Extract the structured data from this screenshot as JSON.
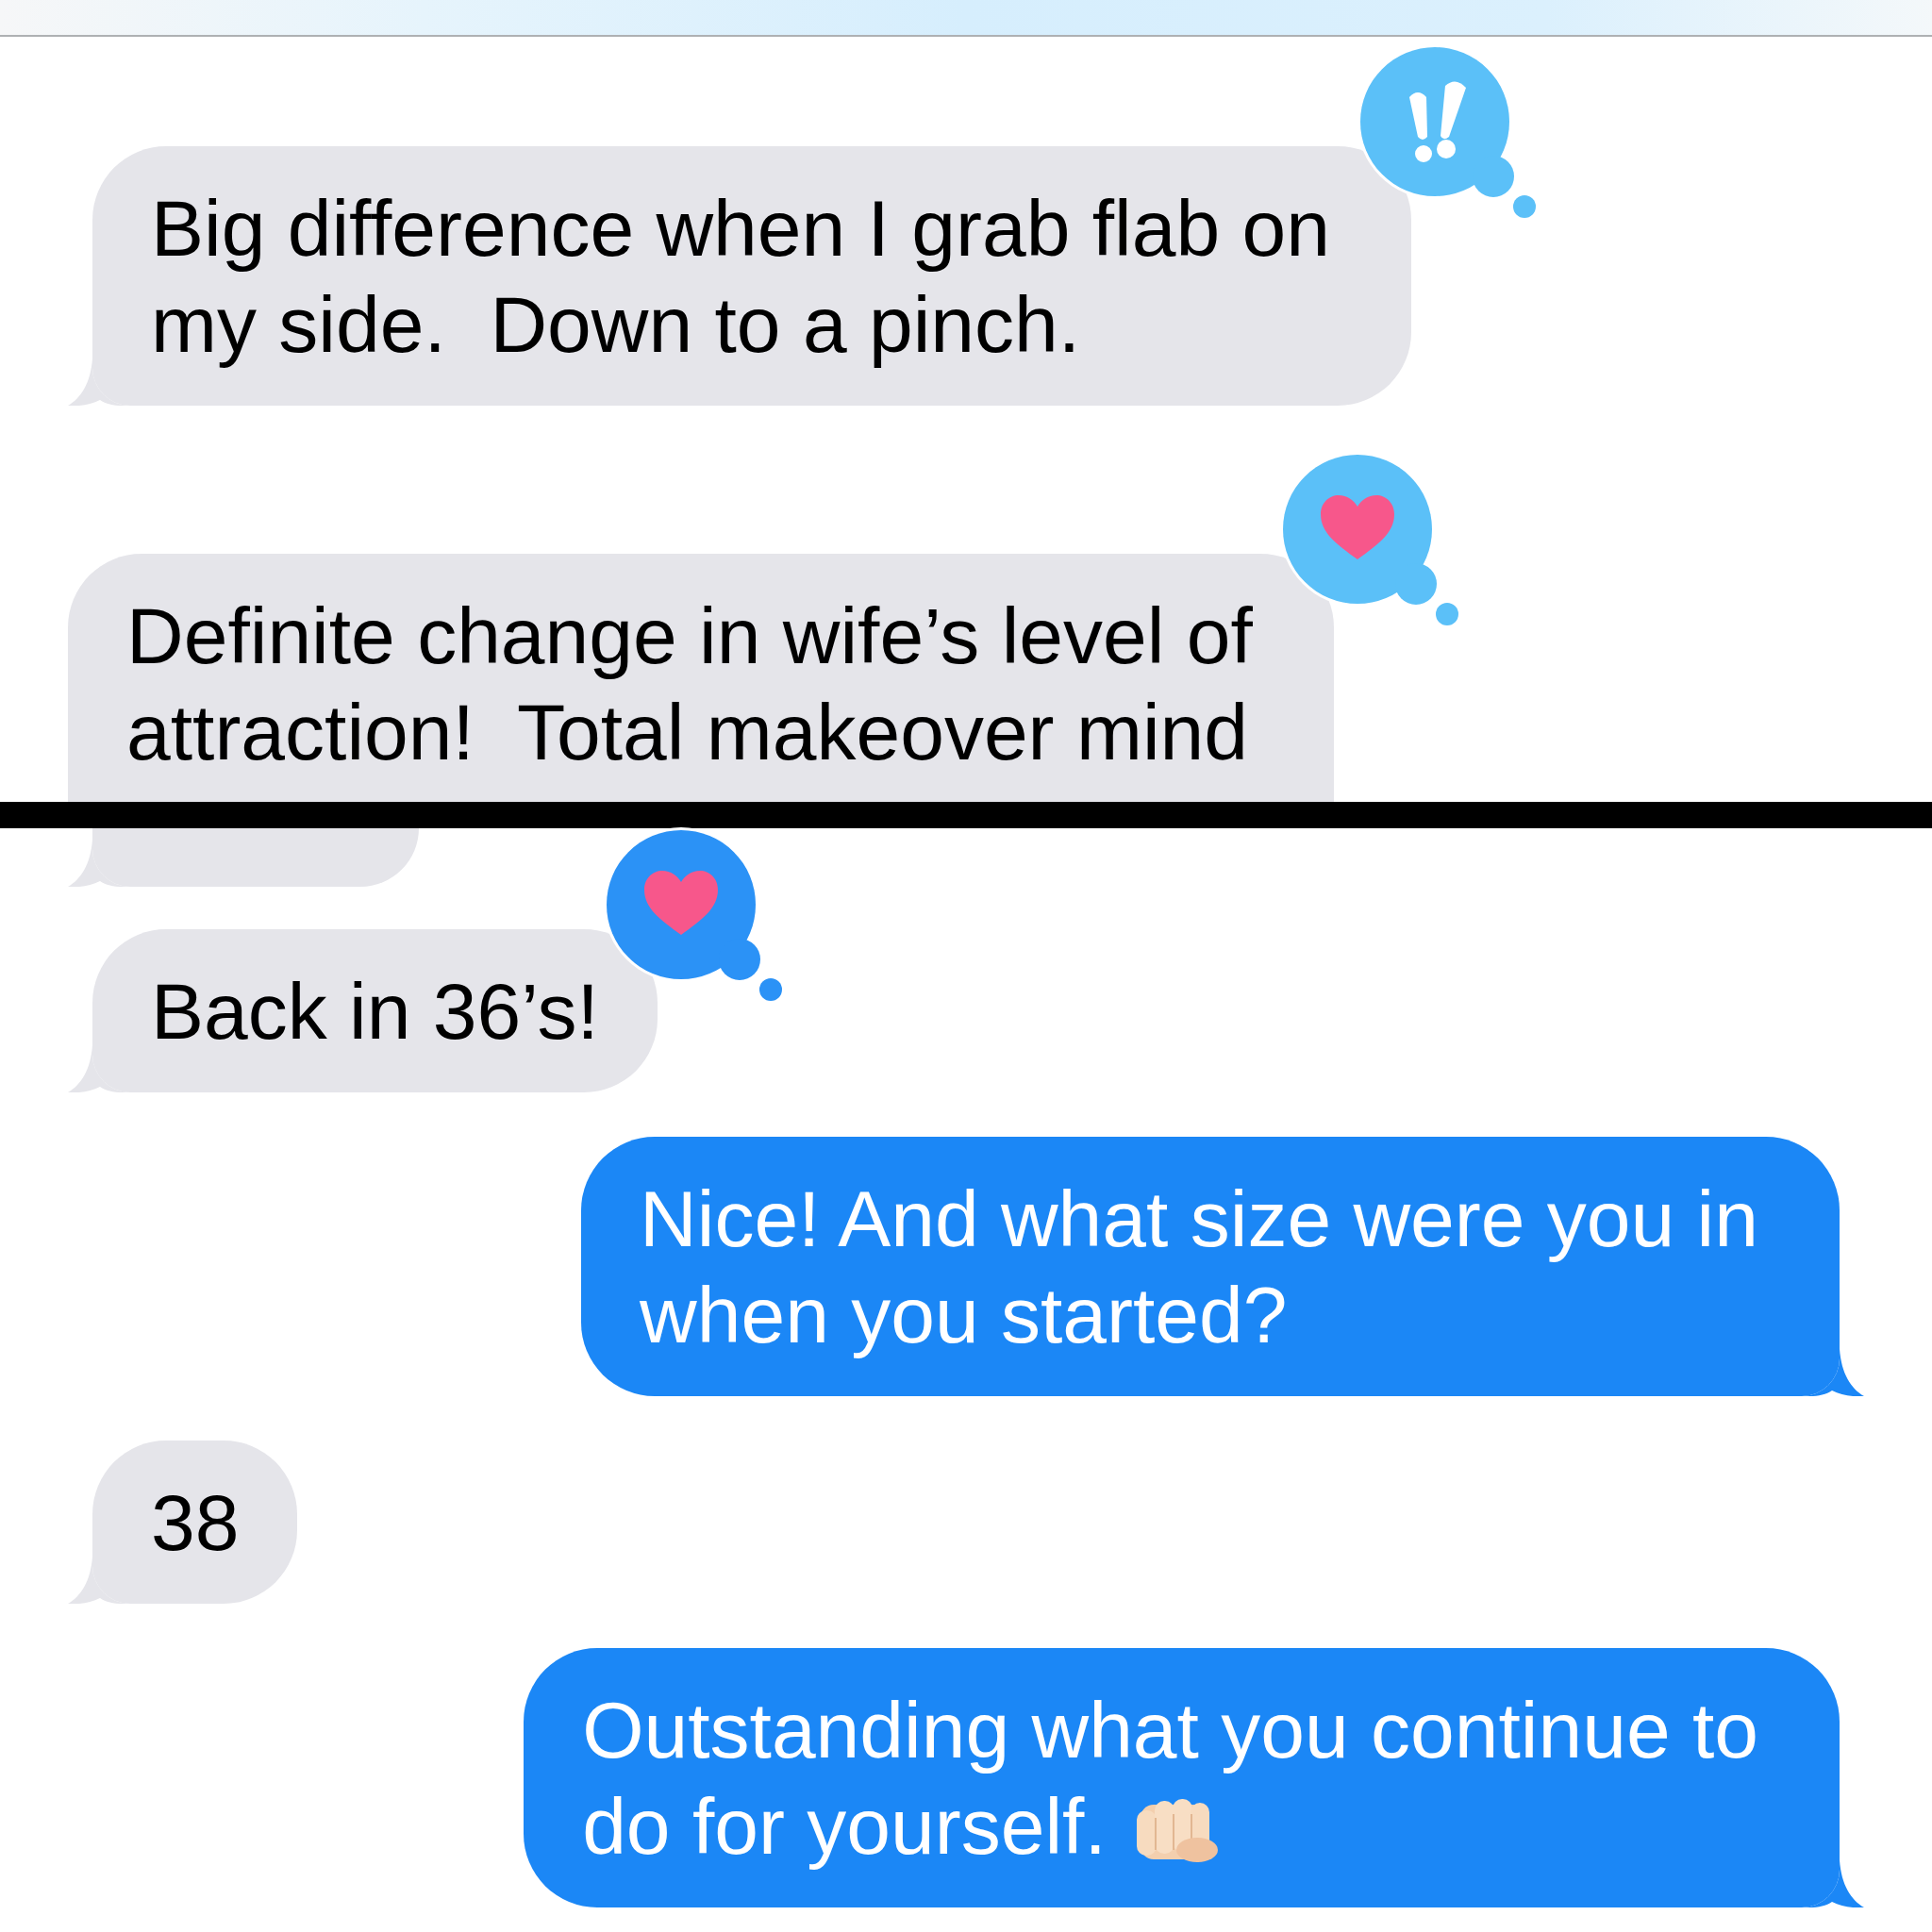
{
  "screenshots": [
    {
      "messages": [
        {
          "kind": "received",
          "lines": [
            "Big difference when I grab flab on",
            "my side.  Down to a pinch."
          ],
          "reaction": {
            "kind": "emphasis",
            "color": "#5bc0f8"
          }
        },
        {
          "kind": "received",
          "cut_bottom": true,
          "lines": [
            "Definite change in wife’s level of",
            "attraction!  Total makeover mind"
          ],
          "reaction": {
            "kind": "heart",
            "color": "#5bc0f8"
          }
        }
      ]
    },
    {
      "messages": [
        {
          "kind": "received",
          "cut_top": true
        },
        {
          "kind": "received",
          "lines": [
            "Back in 36’s!"
          ],
          "reaction": {
            "kind": "heart",
            "color": "#2b92f6"
          }
        },
        {
          "kind": "sent",
          "lines": [
            "Nice! And what size were you in",
            "when you started?"
          ]
        },
        {
          "kind": "received",
          "lines": [
            "38"
          ]
        },
        {
          "kind": "sent",
          "lines": [
            "Outstanding what you continue to",
            "do for yourself."
          ],
          "emoji": true
        }
      ]
    }
  ]
}
